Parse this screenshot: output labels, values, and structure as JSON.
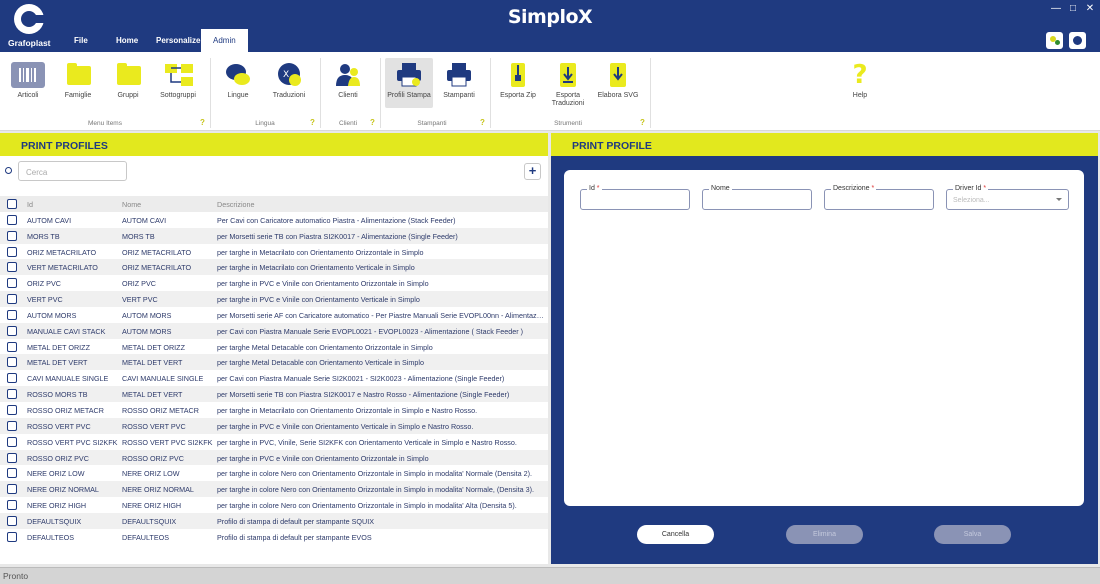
{
  "app": {
    "title": "SimploX",
    "logo_text": "Grafoplast"
  },
  "menu": [
    {
      "label": "File"
    },
    {
      "label": "Home"
    },
    {
      "label": "Personalize"
    },
    {
      "label": "Admin",
      "active": true
    }
  ],
  "window_controls": {
    "minimize": "—",
    "maximize": "□",
    "close": "✕"
  },
  "ribbon": {
    "items": [
      {
        "label": "Articoli",
        "icon": "barcode-icon"
      },
      {
        "label": "Famiglie",
        "icon": "folder-icon"
      },
      {
        "label": "Gruppi",
        "icon": "folder-icon"
      },
      {
        "label": "Sottogruppi",
        "icon": "folder-tree-icon"
      },
      {
        "label": "Lingue",
        "icon": "chat-icon"
      },
      {
        "label": "Traduzioni",
        "icon": "translate-icon"
      },
      {
        "label": "Clienti",
        "icon": "users-icon"
      },
      {
        "label": "Profili Stampa",
        "icon": "printer-profile-icon",
        "selected": true
      },
      {
        "label": "Stampanti",
        "icon": "printer-icon"
      },
      {
        "label": "Esporta Zip",
        "icon": "zip-icon"
      },
      {
        "label": "Esporta",
        "label2": "Traduzioni",
        "icon": "export-file-icon"
      },
      {
        "label": "Elabora SVG",
        "icon": "svg-file-icon"
      },
      {
        "label": "Help",
        "icon": "help-icon"
      }
    ],
    "groups": [
      {
        "label": "Menu Items"
      },
      {
        "label": "Lingua"
      },
      {
        "label": "Clienti"
      },
      {
        "label": "Stampanti"
      },
      {
        "label": "Strumenti"
      }
    ],
    "group_help": "?"
  },
  "left_panel": {
    "title": "PRINT PROFILES",
    "search_placeholder": "Cerca",
    "add_label": "+",
    "columns": {
      "id": "Id",
      "nome": "Nome",
      "descrizione": "Descrizione"
    },
    "rows": [
      {
        "id": "AUTOM CAVI",
        "nome": "AUTOM CAVI",
        "descrizione": "Per Cavi con Caricatore automatico Piastra - Alimentazione (Stack Feeder)"
      },
      {
        "id": "MORS TB",
        "nome": "MORS TB",
        "descrizione": "per Morsetti serie TB con Piastra SI2K0017 - Alimentazione (Single Feeder)"
      },
      {
        "id": "ORIZ METACRILATO",
        "nome": "ORIZ METACRILATO",
        "descrizione": "per targhe in Metacrilato con Orientamento Orizzontale in Simplo"
      },
      {
        "id": "VERT METACRILATO",
        "nome": "ORIZ METACRILATO",
        "descrizione": "per targhe in Metacrilato con Orientamento Verticale in Simplo"
      },
      {
        "id": "ORIZ PVC",
        "nome": "ORIZ PVC",
        "descrizione": "per targhe in PVC e Vinile con Orientamento Orizzontale in Simplo"
      },
      {
        "id": "VERT PVC",
        "nome": "VERT PVC",
        "descrizione": "per targhe in PVC e Vinile con Orientamento Verticale in Simplo"
      },
      {
        "id": "AUTOM MORS",
        "nome": "AUTOM MORS",
        "descrizione": "per Morsetti serie AF con Caricatore automatico - Per Piastre Manuali Serie EVOPL00nn - Alimentazione (Stack Feeder)"
      },
      {
        "id": "MANUALE CAVI STACK",
        "nome": "AUTOM MORS",
        "descrizione": "per Cavi con Piastra Manuale Serie EVOPL0021 - EVOPL0023 - Alimentazione ( Stack Feeder )"
      },
      {
        "id": "METAL DET ORIZZ",
        "nome": "METAL DET ORIZZ",
        "descrizione": "per targhe Metal Detacable con Orientamento Orizzontale in Simplo"
      },
      {
        "id": "METAL DET VERT",
        "nome": "METAL DET VERT",
        "descrizione": "per targhe Metal Detacable con Orientamento Verticale in Simplo"
      },
      {
        "id": "CAVI MANUALE SINGLE",
        "nome": "CAVI MANUALE SINGLE",
        "descrizione": "per Cavi con Piastra Manuale Serie SI2K0021 - SI2K0023 - Alimentazione (Single Feeder)"
      },
      {
        "id": "ROSSO MORS TB",
        "nome": "METAL DET VERT",
        "descrizione": "per Morsetti serie TB con Piastra SI2K0017 e Nastro Rosso - Alimentazione (Single Feeder)"
      },
      {
        "id": "ROSSO ORIZ METACR",
        "nome": "ROSSO ORIZ METACR",
        "descrizione": "per targhe in Metacrilato con Orientamento Orizzontale in Simplo e Nastro Rosso."
      },
      {
        "id": "ROSSO VERT PVC",
        "nome": "ROSSO VERT PVC",
        "descrizione": "per targhe in PVC e Vinile con Orientamento Verticale in Simplo e Nastro Rosso."
      },
      {
        "id": "ROSSO VERT PVC SI2KFK",
        "nome": "ROSSO VERT PVC SI2KFK",
        "descrizione": "per targhe in PVC, Vinile, Serie SI2KFK con Orientamento Verticale in Simplo e Nastro Rosso."
      },
      {
        "id": "ROSSO ORIZ PVC",
        "nome": "ROSSO ORIZ PVC",
        "descrizione": "per targhe in PVC e Vinile con Orientamento Orizzontale in Simplo"
      },
      {
        "id": "NERE ORIZ LOW",
        "nome": "NERE ORIZ LOW",
        "descrizione": "per targhe in colore Nero con Orientamento Orizzontale in Simplo in modalita' Normale (Densita 2)."
      },
      {
        "id": "NERE ORIZ NORMAL",
        "nome": "NERE ORIZ NORMAL",
        "descrizione": "per targhe in colore Nero con Orientamento Orizzontale in Simplo in modalita' Normale, (Densita 3)."
      },
      {
        "id": "NERE ORIZ HIGH",
        "nome": "NERE ORIZ HIGH",
        "descrizione": "per targhe in colore Nero con Orientamento Orizzontale in Simplo in modalita' Alta (Densita 5)."
      },
      {
        "id": "DEFAULTSQUIX",
        "nome": "DEFAULTSQUIX",
        "descrizione": "Profilo di stampa di default per stampante SQUIX"
      },
      {
        "id": "DEFAULTEOS",
        "nome": "DEFAULTEOS",
        "descrizione": "Profilo di stampa di default per stampante EVOS"
      }
    ]
  },
  "right_panel": {
    "title": "PRINT PROFILE",
    "fields": {
      "id_label": "Id",
      "nome_label": "Nome",
      "descrizione_label": "Descrizione",
      "driver_label": "Driver Id",
      "required_mark": "*",
      "driver_placeholder": "Seleziona..."
    },
    "buttons": {
      "cancel": "Cancella",
      "delete": "Elimina",
      "save": "Salva"
    }
  },
  "status": {
    "text": "Pronto"
  },
  "colors": {
    "brand_blue": "#1f3a80",
    "accent_yellow": "#e2e81e"
  }
}
